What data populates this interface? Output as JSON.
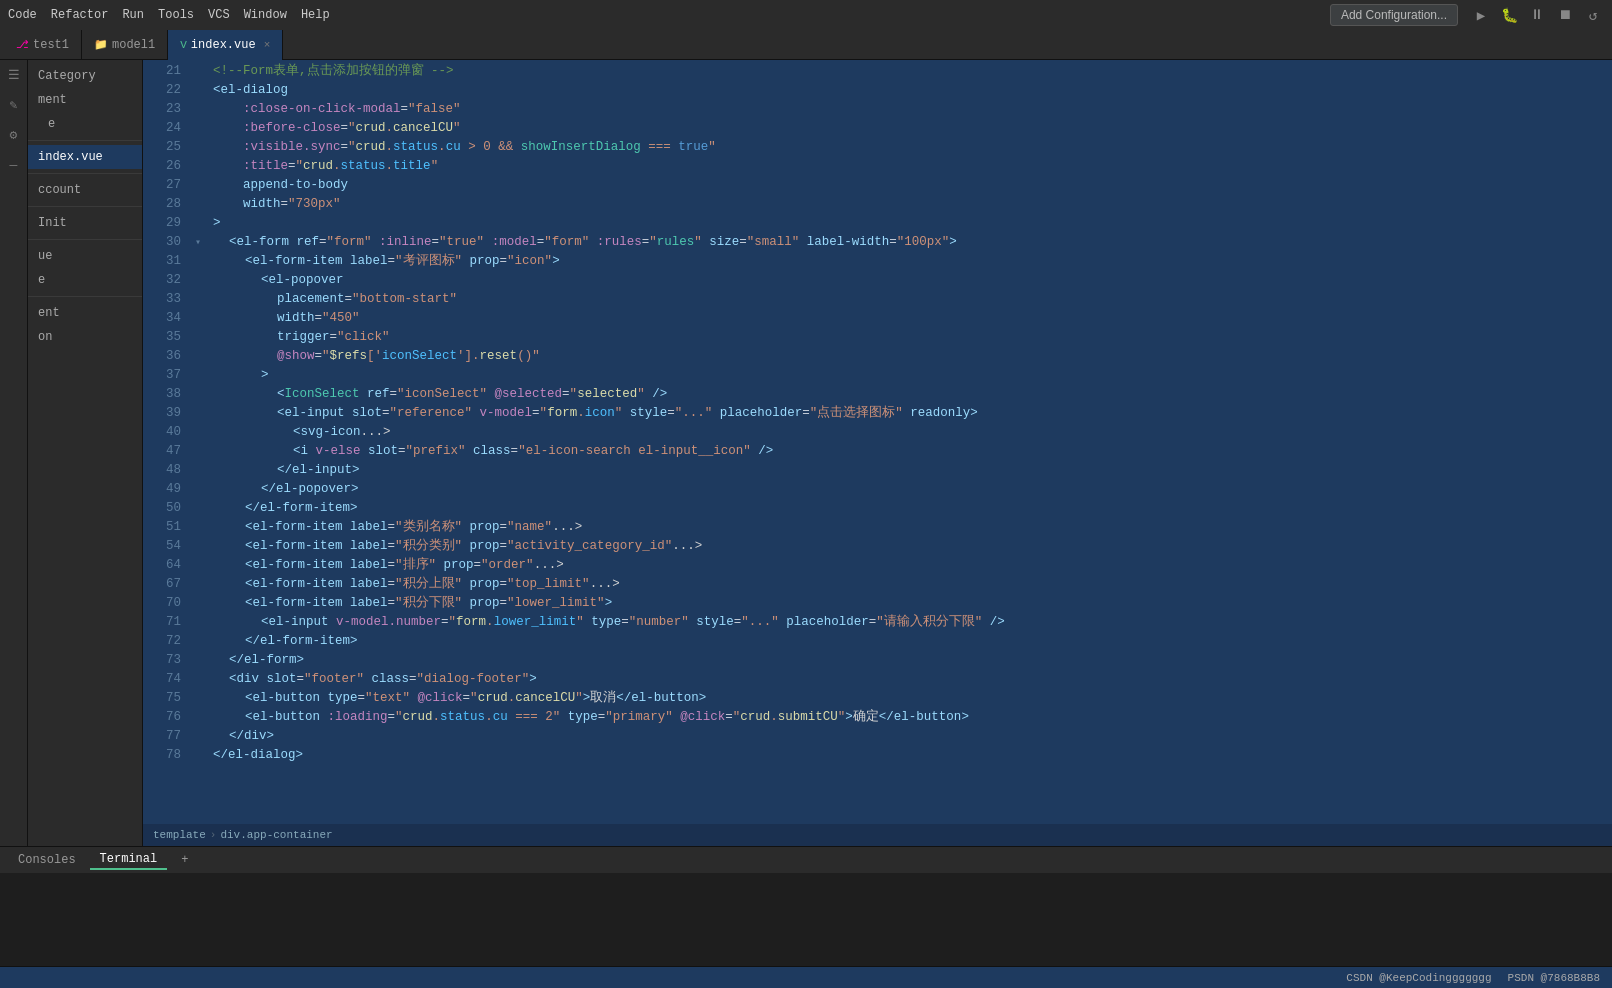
{
  "topbar": {
    "menu_items": [
      "Code",
      "Refactor",
      "Run",
      "Tools",
      "VCS",
      "Window",
      "Help"
    ],
    "tabs": [
      {
        "id": "test1",
        "icon": "git",
        "label": "test1",
        "active": false,
        "closable": false
      },
      {
        "id": "model1",
        "icon": "folder",
        "label": "model1",
        "active": false,
        "closable": false
      },
      {
        "id": "index.vue",
        "icon": "vue",
        "label": "index.vue",
        "active": true,
        "closable": true
      }
    ],
    "add_config_label": "Add Configuration...",
    "run_icons": [
      "▶",
      "⏸",
      "⏹",
      "↺",
      "⚡"
    ]
  },
  "tool_icons": [
    "☰",
    "✎",
    "⚙",
    "—"
  ],
  "sidebar": {
    "items": [
      {
        "label": "Category",
        "level": 0,
        "active": false
      },
      {
        "label": "ment",
        "level": 0,
        "active": false
      },
      {
        "label": "e",
        "level": 1,
        "active": false
      },
      {
        "label": "",
        "level": 0,
        "divider": true
      },
      {
        "label": "index.vue",
        "level": 0,
        "active": true
      },
      {
        "label": "",
        "level": 0,
        "divider": true
      },
      {
        "label": "ccount",
        "level": 0,
        "active": false
      },
      {
        "label": "",
        "level": 0,
        "divider": true
      },
      {
        "label": "Init",
        "level": 0,
        "active": false
      },
      {
        "label": "",
        "level": 0,
        "divider": true
      },
      {
        "label": "ue",
        "level": 0,
        "active": false
      },
      {
        "label": "e",
        "level": 0,
        "active": false
      },
      {
        "label": "",
        "level": 0,
        "divider": true
      },
      {
        "label": "ent",
        "level": 0,
        "active": false
      },
      {
        "label": "on",
        "level": 0,
        "active": false
      }
    ]
  },
  "code": {
    "lines": [
      {
        "num": 21,
        "content": "<!--Form表单,点击添加按钮的弹窗 -->",
        "type": "comment",
        "fold": false,
        "highlight": false
      },
      {
        "num": 22,
        "content": "<el-dialog",
        "type": "code",
        "fold": false,
        "highlight": false
      },
      {
        "num": 23,
        "content": "  :close-on-click-modal=\"false\"",
        "type": "code",
        "fold": false,
        "highlight": false
      },
      {
        "num": 24,
        "content": "  :before-close=\"crud.cancelCU\"",
        "type": "code",
        "fold": false,
        "highlight": false
      },
      {
        "num": 25,
        "content": "  :visible.sync=\"crud.status.cu > 0 && showInsertDialog === true\"",
        "type": "code",
        "fold": false,
        "highlight": false
      },
      {
        "num": 26,
        "content": "  :title=\"crud.status.title\"",
        "type": "code",
        "fold": false,
        "highlight": false
      },
      {
        "num": 27,
        "content": "  append-to-body",
        "type": "code",
        "fold": false,
        "highlight": false
      },
      {
        "num": 28,
        "content": "  width=\"730px\"",
        "type": "code",
        "fold": false,
        "highlight": false
      },
      {
        "num": 29,
        "content": ">",
        "type": "code",
        "fold": false,
        "highlight": false
      },
      {
        "num": 30,
        "content": "  <el-form ref=\"form\" :inline=\"true\" :model=\"form\" :rules=\"rules\" size=\"small\" label-width=\"100px\">",
        "type": "code",
        "fold": true,
        "highlight": false
      },
      {
        "num": 31,
        "content": "    <el-form-item label=\"考评图标\" prop=\"icon\">",
        "type": "code",
        "fold": false,
        "highlight": false
      },
      {
        "num": 32,
        "content": "      <el-popover",
        "type": "code",
        "fold": false,
        "highlight": false
      },
      {
        "num": 33,
        "content": "        placement=\"bottom-start\"",
        "type": "code",
        "fold": false,
        "highlight": false
      },
      {
        "num": 34,
        "content": "        width=\"450\"",
        "type": "code",
        "fold": false,
        "highlight": false
      },
      {
        "num": 35,
        "content": "        trigger=\"click\"",
        "type": "code",
        "fold": false,
        "highlight": false
      },
      {
        "num": 36,
        "content": "        @show=\"$refs['iconSelect'].reset()\"",
        "type": "code",
        "fold": false,
        "highlight": false
      },
      {
        "num": 37,
        "content": "      >",
        "type": "code",
        "fold": false,
        "highlight": false
      },
      {
        "num": 38,
        "content": "        <IconSelect ref=\"iconSelect\" @selected=\"selected\" />",
        "type": "code",
        "fold": false,
        "highlight": false
      },
      {
        "num": 39,
        "content": "        <el-input slot=\"reference\" v-model=\"form.icon\" style=\"...\" placeholder=\"点击选择图标\" readonly>",
        "type": "code",
        "fold": false,
        "highlight": false
      },
      {
        "num": 40,
        "content": "          <svg-icon...>",
        "type": "code",
        "fold": false,
        "highlight": false
      },
      {
        "num": 47,
        "content": "          <i v-else slot=\"prefix\" class=\"el-icon-search el-input__icon\" />",
        "type": "code",
        "fold": false,
        "highlight": false
      },
      {
        "num": 48,
        "content": "        </el-input>",
        "type": "code",
        "fold": false,
        "highlight": false
      },
      {
        "num": 49,
        "content": "      </el-popover>",
        "type": "code",
        "fold": false,
        "highlight": false
      },
      {
        "num": 50,
        "content": "    </el-form-item>",
        "type": "code",
        "fold": false,
        "highlight": false
      },
      {
        "num": 51,
        "content": "    <el-form-item label=\"类别名称\" prop=\"name\"...>",
        "type": "code",
        "fold": false,
        "highlight": false
      },
      {
        "num": 54,
        "content": "    <el-form-item label=\"积分类别\" prop=\"activity_category_id\"...>",
        "type": "code",
        "fold": false,
        "highlight": false
      },
      {
        "num": 64,
        "content": "    <el-form-item label=\"排序\" prop=\"order\"...>",
        "type": "code",
        "fold": false,
        "highlight": false
      },
      {
        "num": 67,
        "content": "    <el-form-item label=\"积分上限\" prop=\"top_limit\"...>",
        "type": "code",
        "fold": false,
        "highlight": false
      },
      {
        "num": 70,
        "content": "    <el-form-item label=\"积分下限\" prop=\"lower_limit\">",
        "type": "code",
        "fold": false,
        "highlight": false
      },
      {
        "num": 71,
        "content": "      <el-input v-model.number=\"form.lower_limit\" type=\"number\" style=\"...\" placeholder=\"请输入积分下限\" />",
        "type": "code",
        "fold": false,
        "highlight": false
      },
      {
        "num": 72,
        "content": "    </el-form-item>",
        "type": "code",
        "fold": false,
        "highlight": false
      },
      {
        "num": 73,
        "content": "  </el-form>",
        "type": "code",
        "fold": false,
        "highlight": false
      },
      {
        "num": 74,
        "content": "  <div slot=\"footer\" class=\"dialog-footer\">",
        "type": "code",
        "fold": false,
        "highlight": false
      },
      {
        "num": 75,
        "content": "    <el-button type=\"text\" @click=\"crud.cancelCU\">取消</el-button>",
        "type": "code",
        "fold": false,
        "highlight": false
      },
      {
        "num": 76,
        "content": "    <el-button :loading=\"crud.status.cu === 2\" type=\"primary\" @click=\"crud.submitCU\">确定</el-button>",
        "type": "code",
        "fold": false,
        "highlight": false
      },
      {
        "num": 77,
        "content": "  </div>",
        "type": "code",
        "fold": false,
        "highlight": false
      },
      {
        "num": 78,
        "content": "</el-dialog>",
        "type": "code",
        "fold": false,
        "highlight": false
      }
    ]
  },
  "breadcrumb": {
    "items": [
      "template",
      "div.app-container"
    ]
  },
  "bottom": {
    "tabs": [
      "Consoles",
      "Terminal"
    ],
    "active_tab": "Terminal",
    "add_label": "+",
    "content": ""
  },
  "statusbar": {
    "watermark": "CSDN @KeepCodinggggggg",
    "psdn": "PSDN @7868B8B8"
  }
}
